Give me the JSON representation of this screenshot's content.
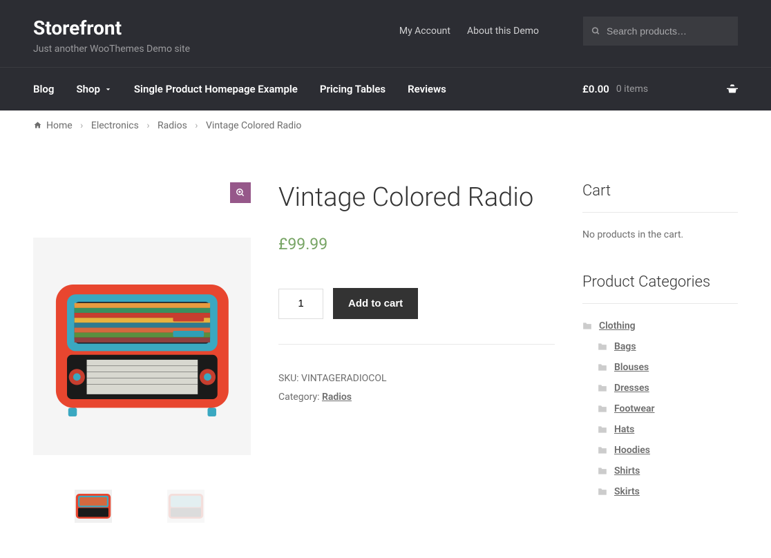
{
  "brand": {
    "title": "Storefront",
    "tagline": "Just another WooThemes Demo site"
  },
  "secondary_nav": {
    "my_account": "My Account",
    "about": "About this Demo"
  },
  "search": {
    "placeholder": "Search products…"
  },
  "main_nav": {
    "blog": "Blog",
    "shop": "Shop",
    "single_product": "Single Product Homepage Example",
    "pricing": "Pricing Tables",
    "reviews": "Reviews"
  },
  "cart_link": {
    "total": "£0.00",
    "items": "0 items"
  },
  "breadcrumb": {
    "home": "Home",
    "electronics": "Electronics",
    "radios": "Radios",
    "current": "Vintage Colored Radio"
  },
  "product": {
    "title": "Vintage Colored Radio",
    "price": "£99.99",
    "qty": "1",
    "add_to_cart": "Add to cart",
    "sku_label": "SKU: ",
    "sku": "VINTAGERADIOCOL",
    "category_label": "Category: ",
    "category": "Radios"
  },
  "sidebar": {
    "cart": {
      "title": "Cart",
      "empty": "No products in the cart."
    },
    "categories": {
      "title": "Product Categories",
      "items": [
        {
          "label": "Clothing",
          "sub": false
        },
        {
          "label": "Bags",
          "sub": true
        },
        {
          "label": "Blouses",
          "sub": true
        },
        {
          "label": "Dresses",
          "sub": true
        },
        {
          "label": "Footwear",
          "sub": true
        },
        {
          "label": "Hats",
          "sub": true
        },
        {
          "label": "Hoodies",
          "sub": true
        },
        {
          "label": "Shirts",
          "sub": true
        },
        {
          "label": "Skirts",
          "sub": true
        }
      ]
    }
  }
}
